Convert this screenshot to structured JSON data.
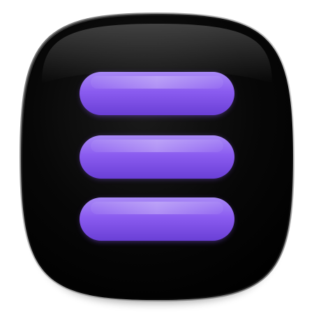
{
  "icon": {
    "name": "hamburger-menu-icon",
    "bar_count": 3,
    "colors": {
      "tile": "#060606",
      "tile_highlight": "#3a3a3a",
      "bar": "#8b5cf0",
      "bar_light": "#a98af6",
      "bar_dark": "#6a3fd6",
      "background": "#ffffff"
    }
  }
}
